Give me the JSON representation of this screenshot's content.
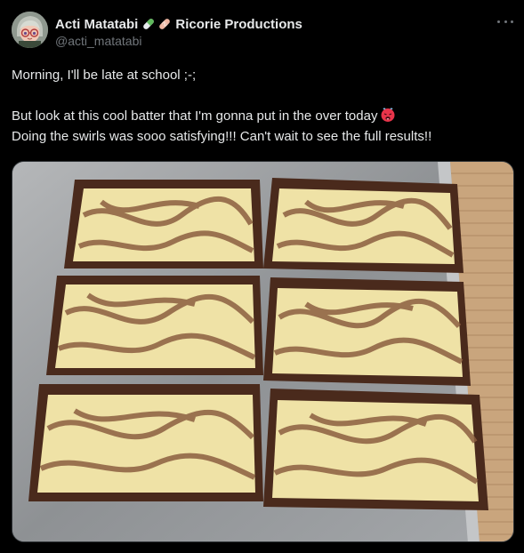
{
  "author": {
    "display_name": "Acti Matatabi",
    "badges": [
      "pill-icon",
      "bandage-icon"
    ],
    "org": "Ricorie Productions",
    "handle": "@acti_matatabi"
  },
  "tweet": {
    "line1": "Morning, I'll be late at school ;-;",
    "line2": "But look at this cool batter that I'm gonna put in the over today",
    "line2_emoji": "hot-face-emoji",
    "line3": "Doing the swirls was sooo satisfying!!! Can't wait to see the full results!!"
  },
  "media": {
    "icon": "photo",
    "colors": {
      "tray": "#9a9c9e",
      "wood": "#c7a27a",
      "mold": "#4a2a1c",
      "batter": "#efe2a6",
      "swirl": "#8b5e3f"
    }
  },
  "colors": {
    "background": "#000000",
    "text": "#e7e9ea",
    "secondary_text": "#71767b"
  }
}
